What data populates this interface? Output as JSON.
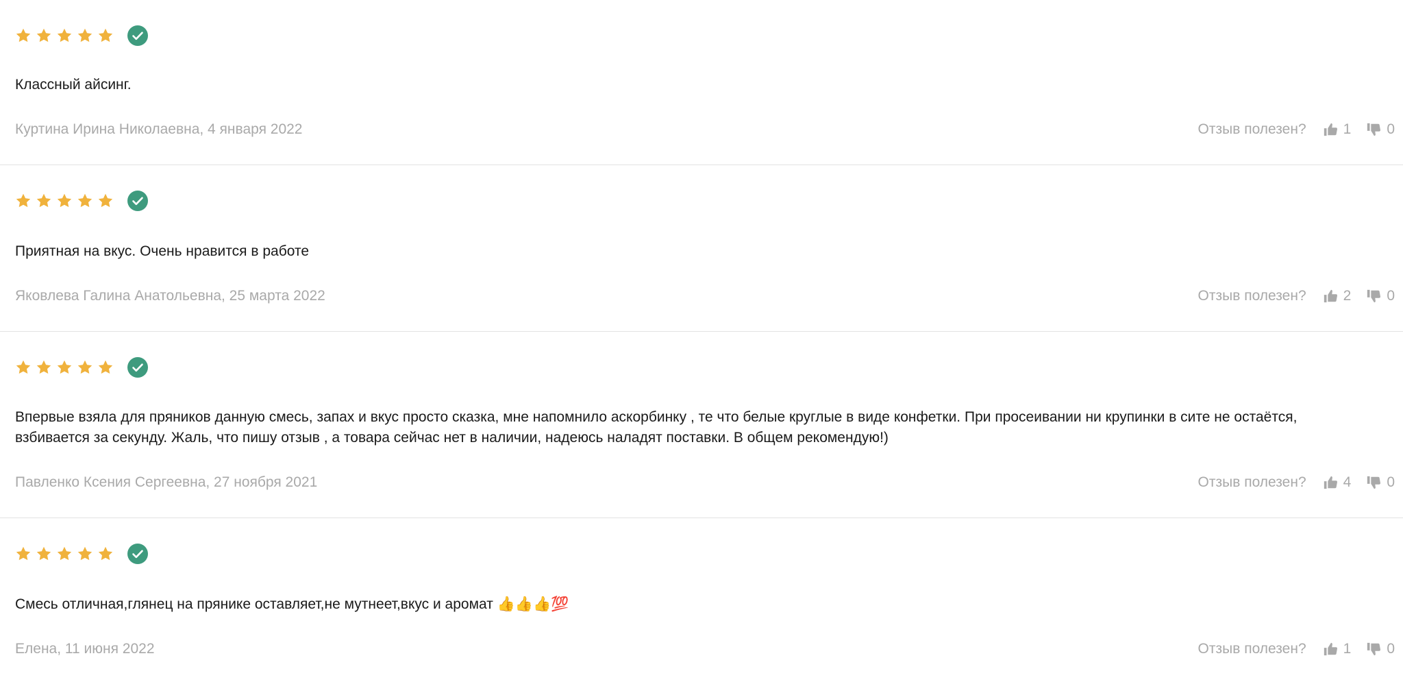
{
  "colors": {
    "star": "#F0B23C",
    "verified": "#3E9B7E",
    "text": "#1A1A1A",
    "muted": "#A9A9A9",
    "divider": "#E2E2E2"
  },
  "helpful_question": "Отзыв полезен?",
  "reviews": [
    {
      "rating": 5,
      "verified": true,
      "text": "Классный айсинг.",
      "author_date": "Куртина Ирина Николаевна, 4 января 2022",
      "likes": "1",
      "dislikes": "0"
    },
    {
      "rating": 5,
      "verified": true,
      "text": "Приятная на вкус. Очень нравится в работе",
      "author_date": "Яковлева Галина Анатольевна, 25 марта 2022",
      "likes": "2",
      "dislikes": "0"
    },
    {
      "rating": 5,
      "verified": true,
      "text": "Впервые взяла для пряников данную смесь, запах и вкус просто сказка, мне напомнило аскорбинку , те что белые круглые в виде конфетки. При просеивании ни крупинки в сите не остаётся, взбивается за секунду. Жаль, что пишу отзыв , а товара сейчас нет в наличии, надеюсь наладят поставки. В общем рекомендую!)",
      "author_date": "Павленко Ксения Сергеевна, 27 ноября 2021",
      "likes": "4",
      "dislikes": "0"
    },
    {
      "rating": 5,
      "verified": true,
      "text": "Смесь отличная,глянец на прянике оставляет,не мутнеет,вкус и аромат 👍👍👍💯",
      "author_date": "Елена, 11 июня 2022",
      "likes": "1",
      "dislikes": "0"
    }
  ]
}
